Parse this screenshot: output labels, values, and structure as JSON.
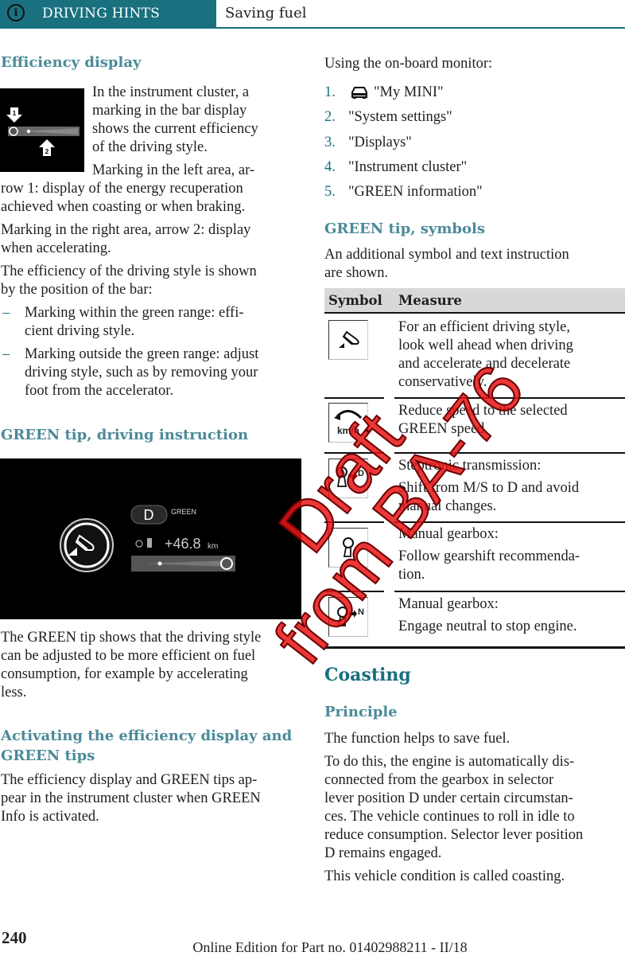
{
  "header": {
    "section": "DRIVING HINTS",
    "title": "Saving fuel",
    "info_icon": "i",
    "accent_color": "#19707f"
  },
  "left": {
    "efficiency": {
      "heading": "Efficiency display",
      "intro_lines": [
        "In the instrument cluster, a",
        "marking in the bar display",
        "shows the current efficiency",
        "of the driving style."
      ],
      "marking_left_lines": [
        "Marking in the left area, ar-",
        "row 1: display of the energy recuperation",
        "achieved when coasting or when braking."
      ],
      "marking_right_lines": [
        "Marking in the right area, arrow 2: display",
        "when accelerating."
      ],
      "position_lines": [
        "The efficiency of the driving style is shown",
        "by the position of the bar:"
      ],
      "bullets": [
        {
          "lines": [
            "Marking within the green range: effi-",
            "cient driving style."
          ]
        },
        {
          "lines": [
            "Marking outside the green range: adjust",
            "driving style, such as by removing your",
            "foot from the accelerator."
          ]
        }
      ],
      "image_arrow_labels": [
        "1",
        "2"
      ]
    },
    "green_tip": {
      "heading": "GREEN tip, driving instruction",
      "cluster": {
        "gear": "D",
        "mode": "GREEN",
        "range_gain": "+46.8",
        "range_unit": "km"
      },
      "body_lines": [
        "The GREEN tip shows that the driving style",
        "can be adjusted to be more efficient on fuel",
        "consumption, for example by accelerating",
        "less."
      ]
    },
    "activating": {
      "heading_lines": [
        "Activating the efficiency display and",
        "GREEN tips"
      ],
      "body_lines": [
        "The efficiency display and GREEN tips ap-",
        "pear in the instrument cluster when GREEN",
        "Info is activated."
      ]
    }
  },
  "right": {
    "monitor_intro": "Using the on-board monitor:",
    "steps": [
      {
        "num": "1.",
        "text": "\"My MINI\"",
        "icon": "car-icon"
      },
      {
        "num": "2.",
        "text": "\"System settings\""
      },
      {
        "num": "3.",
        "text": "\"Displays\""
      },
      {
        "num": "4.",
        "text": "\"Instrument cluster\""
      },
      {
        "num": "5.",
        "text": "\"GREEN information\""
      }
    ],
    "symbols": {
      "heading": "GREEN tip, symbols",
      "body_lines": [
        "An additional symbol and text instruction",
        "are shown."
      ],
      "table": {
        "headers": [
          "Symbol",
          "Measure"
        ],
        "rows": [
          {
            "icon": "foot-accelerate-icon",
            "lines": [
              "For an efficient driving style,",
              "look well ahead when driving",
              "and accelerate and decelerate",
              "conservatively."
            ]
          },
          {
            "icon": "reduce-speed-icon",
            "icon_text": "km/h",
            "lines": [
              "Reduce speed to the selected",
              "GREEN speed."
            ]
          },
          {
            "icon": "gear-lever-to-d-icon",
            "icon_text": "D",
            "lines": [
              "Steptronic transmission:",
              "Shift from M/S to D and avoid",
              "manual changes."
            ]
          },
          {
            "icon": "gear-lever-icon",
            "lines": [
              "Manual gearbox:",
              "Follow gearshift recommenda-",
              "tion."
            ]
          },
          {
            "icon": "gear-lever-to-n-icon",
            "icon_text": "N",
            "lines": [
              "Manual gearbox:",
              "Engage neutral to stop engine."
            ]
          }
        ]
      }
    },
    "coasting": {
      "heading": "Coasting",
      "subheading": "Principle",
      "p1": "The function helps to save fuel.",
      "p2_lines": [
        "To do this, the engine is automatically dis-",
        "connected from the gearbox in selector",
        "lever position D under certain circumstan-",
        "ces. The vehicle continues to roll in idle to",
        "reduce consumption. Selector lever position",
        "D remains engaged."
      ],
      "p3": "This vehicle condition is called coasting."
    }
  },
  "watermark": {
    "line1": "Draft",
    "line2": "from BA-76"
  },
  "footer": {
    "page": "240",
    "edition": "Online Edition for Part no. 01402988211 - II/18"
  }
}
